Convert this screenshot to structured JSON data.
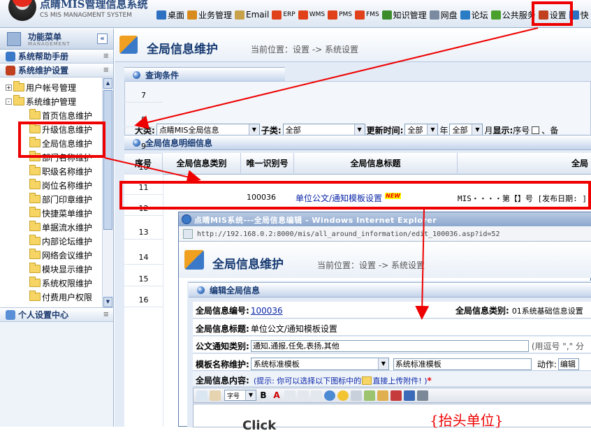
{
  "header": {
    "system_title": "点睛MIS管理信息系统",
    "system_subtitle": "CS MIS MANAGMENT SYSTEM",
    "nav": [
      {
        "label": "桌面",
        "icon": "monitor-icon",
        "color": "#2d6fc0"
      },
      {
        "label": "业务管理",
        "icon": "people-icon",
        "color": "#d98a1c"
      },
      {
        "label": "Email",
        "icon": "mail-icon",
        "color": "#c8a24a"
      },
      {
        "label": "ERP",
        "icon": "erp-globe-icon",
        "color": "#e0401a"
      },
      {
        "label": "WMS",
        "icon": "wms-globe-icon",
        "color": "#e0401a"
      },
      {
        "label": "PMS",
        "icon": "pms-globe-icon",
        "color": "#e0401a"
      },
      {
        "label": "FMS",
        "icon": "fms-globe-icon",
        "color": "#e0401a"
      },
      {
        "label": "知识管理",
        "icon": "knowledge-icon",
        "color": "#3c8c2c"
      },
      {
        "label": "网盘",
        "icon": "disk-icon",
        "color": "#7a8aa0"
      },
      {
        "label": "论坛",
        "icon": "forum-icon",
        "color": "#2a7cc4"
      },
      {
        "label": "公共服务",
        "icon": "public-service-icon",
        "color": "#4aa02c"
      },
      {
        "label": "设置",
        "icon": "settings-tools-icon",
        "color": "#c04020"
      },
      {
        "label": "快",
        "icon": "quick-icon",
        "color": "#2d6fc0"
      }
    ]
  },
  "sidebar": {
    "title": "功能菜单",
    "subtitle": "MANAGEMENT",
    "collapse_symbol": "«",
    "sections": {
      "help": "系统帮助手册",
      "maintenance": "系统维护设置",
      "personal": "个人设置中心"
    },
    "tree": [
      {
        "label": "用户帐号管理",
        "level": 0,
        "toggle": "+"
      },
      {
        "label": "系统维护管理",
        "level": 0,
        "toggle": "-"
      },
      {
        "label": "首页信息维护",
        "level": 1
      },
      {
        "label": "升级信息维护",
        "level": 1
      },
      {
        "label": "全局信息维护",
        "level": 1
      },
      {
        "label": "部门名称维护",
        "level": 1
      },
      {
        "label": "职级名称维护",
        "level": 1
      },
      {
        "label": "岗位名称维护",
        "level": 1
      },
      {
        "label": "部门印章维护",
        "level": 1
      },
      {
        "label": "快捷菜单维护",
        "level": 1
      },
      {
        "label": "单据流水维护",
        "level": 1
      },
      {
        "label": "内部论坛维护",
        "level": 1
      },
      {
        "label": "网络会议维护",
        "level": 1
      },
      {
        "label": "模块显示维护",
        "level": 1
      },
      {
        "label": "系统权限维护",
        "level": 1
      },
      {
        "label": "付费用户权限",
        "level": 1
      }
    ]
  },
  "main": {
    "page_title": "全局信息维护",
    "breadcrumb": "当前位置：设置 -> 系统设置",
    "query": {
      "title": "查询条件",
      "category_label": "大类:",
      "category_value": "点睛MIS全局信息",
      "subcategory_label": "子类:",
      "subcategory_value": "全部",
      "update_label": "更新时间:",
      "year_value": "全部",
      "year_label": "年",
      "month_value": "全部",
      "month_label": "月",
      "display_label": "显示:",
      "seq_label": "序号",
      "sep": "、",
      "extra": "备"
    },
    "detail": {
      "title": "全局信息明细信息",
      "columns": [
        "序号",
        "全局信息类别",
        "唯一识别号",
        "全局信息标题",
        "全局"
      ],
      "row_numbers": [
        "7",
        "8",
        "9",
        "10",
        "11",
        "12",
        "13",
        "14",
        "15",
        "16"
      ],
      "highlight_row": {
        "id": "100036",
        "title": "单位公文/通知模板设置",
        "badge": "NEW",
        "content": "MIS・・・・第【】号 [发布日期: ]"
      }
    }
  },
  "popup": {
    "window_title": "点睛MIS系统---全局信息编辑 - Windows Internet Explorer",
    "url": "http://192.168.0.2:8000/mis/all_around_information/edit_100036.asp?id=52",
    "page_title": "全局信息维护",
    "breadcrumb": "当前位置：设置 -> 系统设置",
    "section_title": "编辑全局信息",
    "fields": {
      "code_label": "全局信息编号:",
      "code_value": "100036",
      "type_label": "全局信息类别:",
      "type_value": "01系统基础信息设置",
      "title_label": "全局信息标题:",
      "title_value": "单位公文/通知模板设置",
      "doc_type_label": "公文通知类别:",
      "doc_type_value": "通知,通报,任免,表扬,其他",
      "doc_type_hint": "(用逗号 \",\" 分",
      "template_label": "模板名称维护:",
      "template_select": "系统标准模板",
      "template_text": "系统标准模板",
      "action_label": "动作:",
      "action_value": "编辑",
      "content_label": "全局信息内容:",
      "content_hint": "(提示: 你可以选择以下图标中的",
      "content_hint2": "直接上传附件! )",
      "required_mark": "*"
    },
    "editor": {
      "font_size": "字号",
      "red_text": "{抬头单位}",
      "grey_text": "Click"
    }
  },
  "colors": {
    "accent_red": "#ee0000",
    "brand_blue": "#173a72",
    "link_blue": "#0b27a8"
  }
}
